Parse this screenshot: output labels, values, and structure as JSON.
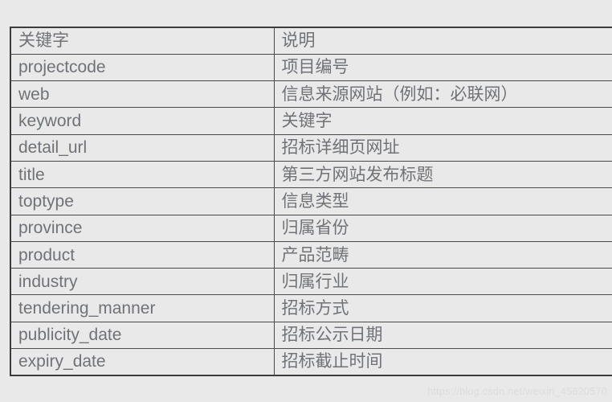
{
  "table": {
    "headers": [
      "关键字",
      "说明"
    ],
    "rows": [
      {
        "keyword": "projectcode",
        "description": "项目编号"
      },
      {
        "keyword": "web",
        "description": "信息来源网站（例如：必联网）"
      },
      {
        "keyword": "keyword",
        "description": "关键字"
      },
      {
        "keyword": "detail_url",
        "description": "招标详细页网址"
      },
      {
        "keyword": "title",
        "description": "第三方网站发布标题"
      },
      {
        "keyword": "toptype",
        "description": "信息类型"
      },
      {
        "keyword": "province",
        "description": "归属省份"
      },
      {
        "keyword": "product",
        "description": "产品范畴"
      },
      {
        "keyword": "industry",
        "description": "归属行业"
      },
      {
        "keyword": "tendering_manner",
        "description": "招标方式"
      },
      {
        "keyword": "publicity_date",
        "description": "招标公示日期"
      },
      {
        "keyword": "expiry_date",
        "description": "招标截止时间"
      }
    ]
  },
  "watermark": {
    "text": "https://blog.csdn.net/weixin_45620570"
  },
  "colors": {
    "background": "#e9e9e9",
    "text": "#6f7378",
    "border": "#4a4a4a",
    "watermark": "#dcdcdc"
  }
}
